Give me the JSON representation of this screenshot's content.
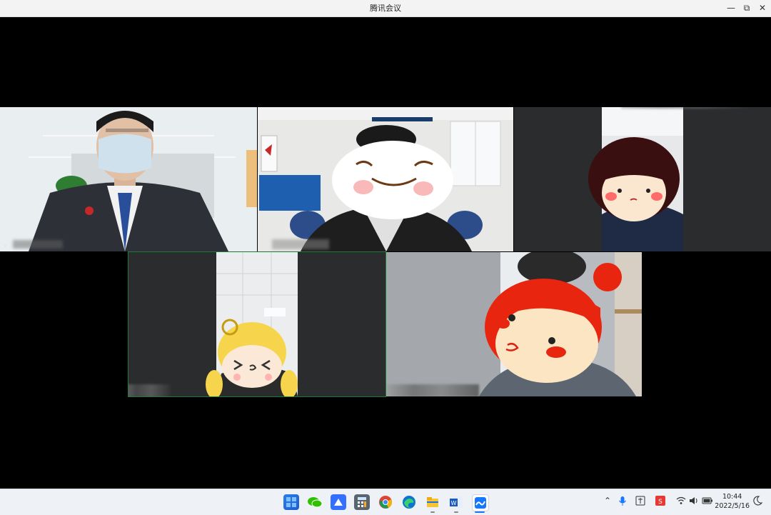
{
  "window": {
    "title": "腾讯会议",
    "minimize_icon": "minimize-icon",
    "restore_icon": "restore-icon",
    "close_icon": "close-icon"
  },
  "participants": [
    {
      "tile": "top-left",
      "video": "man-in-suit-with-mask",
      "name_label_blurred": true
    },
    {
      "tile": "top-center",
      "video": "person-with-cartoon-face-sticker",
      "name_label_blurred": true
    },
    {
      "tile": "top-right",
      "video": "person-with-bob-hair-sticker",
      "name_label_blurred": true
    },
    {
      "tile": "bottom-left",
      "video": "person-with-blonde-girl-sticker",
      "name_label_blurred": true,
      "active_speaker": true
    },
    {
      "tile": "bottom-right",
      "video": "person-with-red-hair-sticker",
      "name_label_blurred": true
    }
  ],
  "taskbar": {
    "apps": [
      "windows-start-icon",
      "wechat-icon",
      "feishu-icon",
      "calculator-icon",
      "chrome-icon",
      "edge-icon",
      "file-explorer-icon",
      "word-icon",
      "tencent-meeting-icon"
    ],
    "tray": [
      "chevron-up-icon",
      "microphone-icon",
      "input-method-icon",
      "wps-icon",
      "wifi-icon",
      "volume-icon",
      "battery-icon"
    ],
    "time": "10:44",
    "date": "2022/5/16",
    "notification_icon": "moon-icon"
  },
  "colors": {
    "active_border": "#1f7a3a",
    "tile_gray": "#2a2c2d",
    "taskbar_bg": "#eef1f5"
  }
}
